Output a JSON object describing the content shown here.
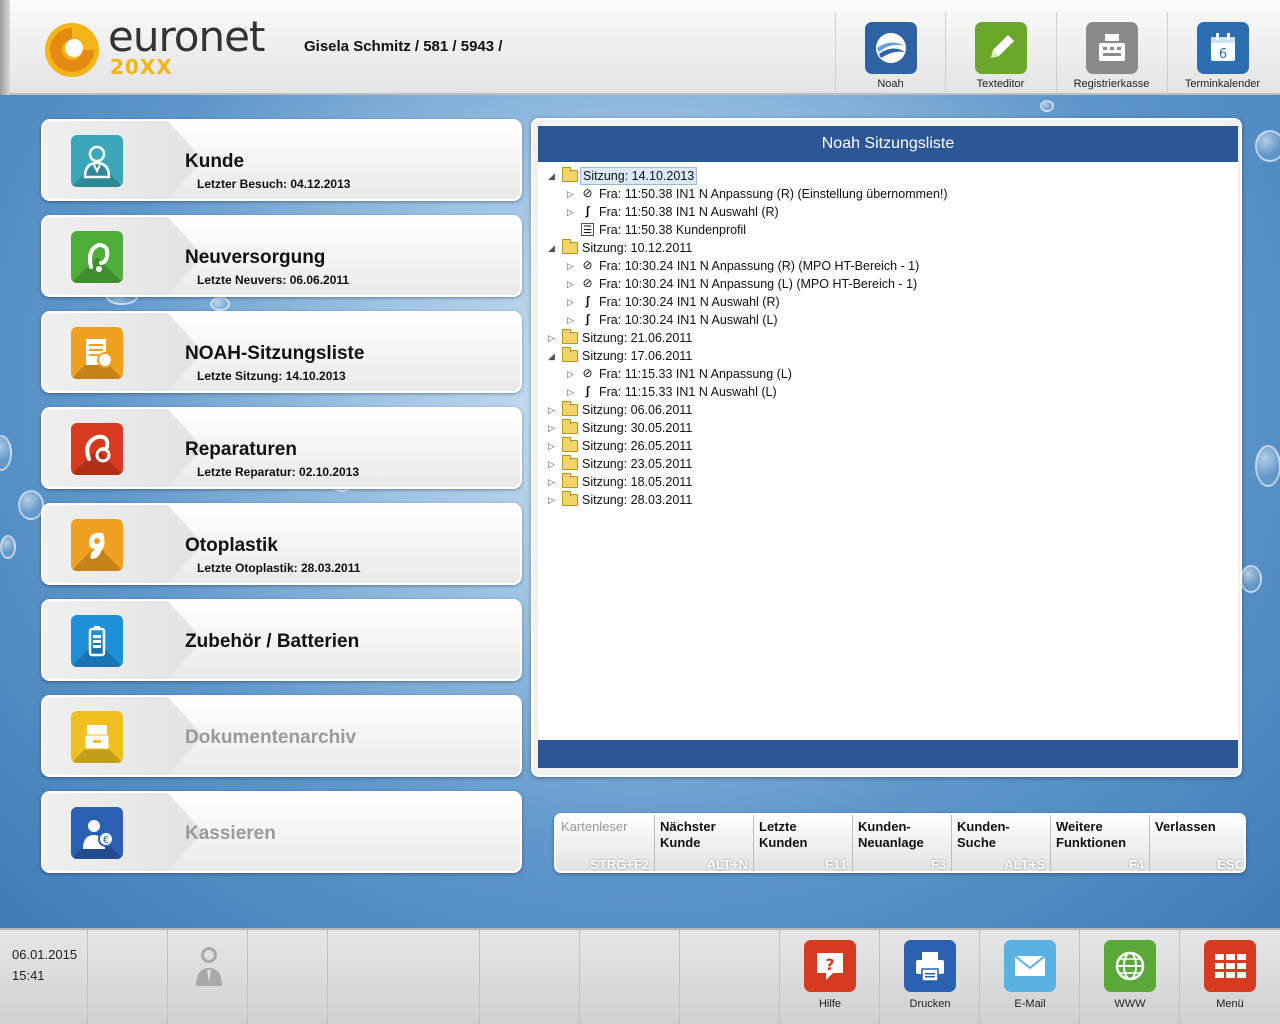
{
  "header": {
    "logo_text": "euronet",
    "logo_sub": "20XX",
    "customer": "Gisela Schmitz / 581 / 5943 /",
    "buttons": [
      {
        "label": "Noah",
        "icon": "noah-icon",
        "color": "#2f62a3"
      },
      {
        "label": "Texteditor",
        "icon": "pencil-icon",
        "color": "#6aa72a"
      },
      {
        "label": "Registrierkasse",
        "icon": "cash-register-icon",
        "color": "#8a8a8a"
      },
      {
        "label": "Terminkalender",
        "icon": "calendar-icon",
        "color": "#2b6fb0"
      }
    ]
  },
  "cards": [
    {
      "title": "Kunde",
      "subtitle": "Letzter Besuch: 04.12.2013",
      "icon": "customer-icon",
      "color": "#3aa6b8",
      "enabled": true
    },
    {
      "title": "Neuversorgung",
      "subtitle": "Letzte Neuvers: 06.06.2011",
      "icon": "hearing-aid-icon",
      "color": "#4fae3a",
      "enabled": true
    },
    {
      "title": "NOAH-Sitzungsliste",
      "subtitle": "Letzte Sitzung: 14.10.2013",
      "icon": "session-list-icon",
      "color": "#f0a020",
      "enabled": true
    },
    {
      "title": "Reparaturen",
      "subtitle": "Letzte Reparatur: 02.10.2013",
      "icon": "repair-icon",
      "color": "#d83a1f",
      "enabled": true
    },
    {
      "title": "Otoplastik",
      "subtitle": "Letzte Otoplastik: 28.03.2011",
      "icon": "earmold-icon",
      "color": "#f0a020",
      "enabled": true
    },
    {
      "title": "Zubehör / Batterien",
      "subtitle": "",
      "icon": "battery-icon",
      "color": "#1f8fd8",
      "enabled": true
    },
    {
      "title": "Dokumentenarchiv",
      "subtitle": "",
      "icon": "archive-icon",
      "color": "#f0c020",
      "enabled": false
    },
    {
      "title": "Kassieren",
      "subtitle": "",
      "icon": "cashier-icon",
      "color": "#2b5fb0",
      "enabled": false
    }
  ],
  "panel": {
    "title": "Noah Sitzungsliste",
    "tree": [
      {
        "level": 0,
        "expanded": true,
        "selected": true,
        "type": "folder",
        "text": "Sitzung: 14.10.2013"
      },
      {
        "level": 1,
        "type": "fit",
        "text": "Fra: 11:50.38 IN1 N Anpassung (R) (Einstellung übernommen!)"
      },
      {
        "level": 1,
        "type": "aid",
        "text": "Fra: 11:50.38 IN1 N Auswahl (R)"
      },
      {
        "level": 1,
        "type": "doc",
        "text": "Fra: 11:50.38 Kundenprofil"
      },
      {
        "level": 0,
        "expanded": true,
        "type": "folder",
        "text": "Sitzung: 10.12.2011"
      },
      {
        "level": 1,
        "type": "fit",
        "text": "Fra: 10:30.24 IN1 N Anpassung (R) (MPO HT-Bereich - 1)"
      },
      {
        "level": 1,
        "type": "fit",
        "text": "Fra: 10:30.24 IN1 N Anpassung (L) (MPO HT-Bereich - 1)"
      },
      {
        "level": 1,
        "type": "aid",
        "text": "Fra: 10:30.24 IN1 N Auswahl (R)"
      },
      {
        "level": 1,
        "type": "aid",
        "text": "Fra: 10:30.24 IN1 N Auswahl (L)"
      },
      {
        "level": 0,
        "expanded": false,
        "type": "folder",
        "text": "Sitzung: 21.06.2011"
      },
      {
        "level": 0,
        "expanded": true,
        "type": "folder",
        "text": "Sitzung: 17.06.2011"
      },
      {
        "level": 1,
        "type": "fit",
        "text": "Fra: 11:15.33 IN1 N Anpassung (L)"
      },
      {
        "level": 1,
        "type": "aid",
        "text": "Fra: 11:15.33 IN1 N Auswahl (L)"
      },
      {
        "level": 0,
        "expanded": false,
        "type": "folder",
        "text": "Sitzung: 06.06.2011"
      },
      {
        "level": 0,
        "expanded": false,
        "type": "folder",
        "text": "Sitzung: 30.05.2011"
      },
      {
        "level": 0,
        "expanded": false,
        "type": "folder",
        "text": "Sitzung: 26.05.2011"
      },
      {
        "level": 0,
        "expanded": false,
        "type": "folder",
        "text": "Sitzung: 23.05.2011"
      },
      {
        "level": 0,
        "expanded": false,
        "type": "folder",
        "text": "Sitzung: 18.05.2011"
      },
      {
        "level": 0,
        "expanded": false,
        "type": "folder",
        "text": "Sitzung: 28.03.2011"
      }
    ]
  },
  "function_keys": [
    {
      "label": "Kartenleser",
      "key": "STRG+F2",
      "enabled": false
    },
    {
      "label": "Nächster\nKunde",
      "key": "ALT+N",
      "enabled": true
    },
    {
      "label": "Letzte\nKunden",
      "key": "F11",
      "enabled": true
    },
    {
      "label": "Kunden-\nNeuanlage",
      "key": "F3",
      "enabled": true
    },
    {
      "label": "Kunden-\nSuche",
      "key": "ALT+S",
      "enabled": true
    },
    {
      "label": "Weitere\nFunktionen",
      "key": "F4",
      "enabled": true
    },
    {
      "label": "Verlassen",
      "key": "ESC",
      "enabled": true
    }
  ],
  "bottom": {
    "date": "06.01.2015",
    "time": "15:41",
    "buttons": [
      {
        "label": "Hilfe",
        "icon": "help-icon",
        "color": "#d83a1f"
      },
      {
        "label": "Drucken",
        "icon": "printer-icon",
        "color": "#2b5fb0"
      },
      {
        "label": "E-Mail",
        "icon": "mail-icon",
        "color": "#5ab0e0"
      },
      {
        "label": "WWW",
        "icon": "globe-icon",
        "color": "#5aa83a"
      },
      {
        "label": "Menü",
        "icon": "menu-grid-icon",
        "color": "#d83a1f"
      }
    ]
  }
}
